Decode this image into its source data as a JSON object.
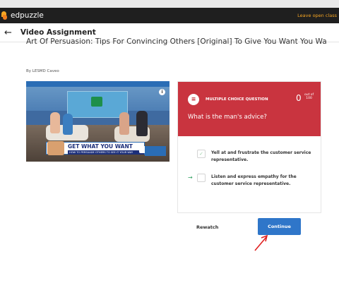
{
  "topbar": {
    "brand": "edpuzzle",
    "leave_label": "Leave open class"
  },
  "header": {
    "title": "Video Assignment"
  },
  "video": {
    "title": "Art Of Persuasion: Tips For Convincing Others [Original] To Give You Want You Want | T...",
    "byline": "By LESMD Caveo",
    "lower_third_title": "GET WHAT YOU WANT",
    "lower_third_sub": "HOW TO PERSUADE OTHERS TO SEE IT YOUR WAY",
    "info_glyph": "i"
  },
  "question": {
    "type_label": "MULTIPLE CHOICE QUESTION",
    "score": "0",
    "out_of_line1": "out of",
    "out_of_line2": "100",
    "text": "What is the man's advice?",
    "choices": [
      {
        "label": "Yell at and frustrate the customer service representative."
      },
      {
        "label": "Listen and express empathy for the customer service representative."
      }
    ]
  },
  "actions": {
    "rewatch_label": "Rewatch",
    "continue_label": "Continue"
  },
  "colors": {
    "accent": "#f6a623",
    "question_header": "#c9343f",
    "primary_button": "#2f76c9",
    "topbar": "#1f1f1f"
  }
}
